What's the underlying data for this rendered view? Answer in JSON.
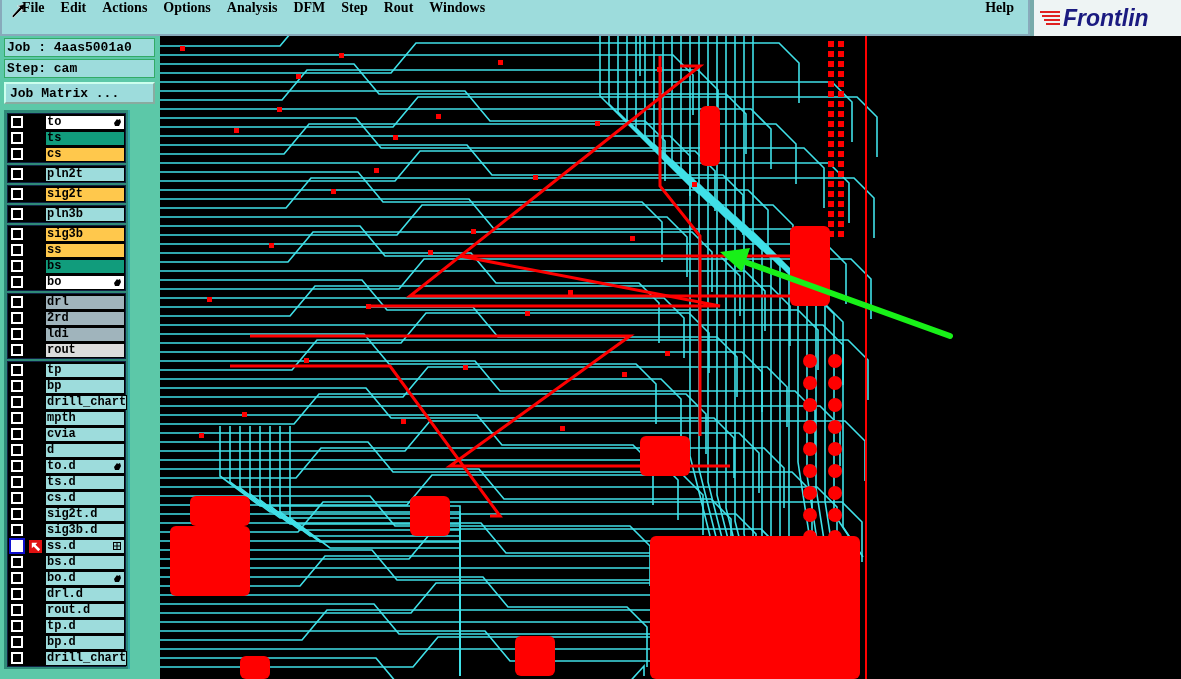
{
  "menu_bar": {
    "items": [
      {
        "label": "File"
      },
      {
        "label": "Edit"
      },
      {
        "label": "Actions"
      },
      {
        "label": "Options"
      },
      {
        "label": "Analysis"
      },
      {
        "label": "DFM"
      },
      {
        "label": "Step"
      },
      {
        "label": "Rout"
      },
      {
        "label": "Windows"
      }
    ],
    "help": "Help"
  },
  "logo": {
    "text": "Frontlin"
  },
  "job_panel": {
    "job": "Job : 4aas5001a0",
    "step": "Step: cam",
    "matrix_button": "Job Matrix ..."
  },
  "layer_groups": [
    {
      "layers": [
        {
          "name": "to",
          "color": "#ffffff",
          "hand_mark": true,
          "checked": false,
          "selected": false
        },
        {
          "name": "ts",
          "color": "#119c7c",
          "checked": false,
          "selected": false
        },
        {
          "name": "cs",
          "color": "#ffc84c",
          "checked": false,
          "selected": false
        }
      ]
    },
    {
      "layers": [
        {
          "name": "pln2t",
          "color": "#9ddcdc",
          "checked": false,
          "selected": false
        }
      ]
    },
    {
      "layers": [
        {
          "name": "sig2t",
          "color": "#ffc84c",
          "checked": false,
          "selected": false
        }
      ]
    },
    {
      "layers": [
        {
          "name": "pln3b",
          "color": "#9ddcdc",
          "checked": false,
          "selected": false
        }
      ]
    },
    {
      "layers": [
        {
          "name": "sig3b",
          "color": "#ffc84c",
          "checked": false,
          "selected": false
        },
        {
          "name": "ss",
          "color": "#ffc84c",
          "checked": false,
          "selected": false
        },
        {
          "name": "bs",
          "color": "#119c7c",
          "checked": false,
          "selected": false
        },
        {
          "name": "bo",
          "color": "#ffffff",
          "hand_mark": true,
          "checked": false,
          "selected": false
        }
      ]
    },
    {
      "layers": [
        {
          "name": "drl",
          "color": "#a0b4bc",
          "checked": false,
          "selected": false
        },
        {
          "name": "2rd",
          "color": "#a0b4bc",
          "checked": false,
          "selected": false
        },
        {
          "name": "ldi",
          "color": "#a0b4bc",
          "checked": false,
          "selected": false
        },
        {
          "name": "rout",
          "color": "#dcdcdc",
          "checked": false,
          "selected": false
        }
      ]
    },
    {
      "layers": [
        {
          "name": "tp",
          "color": "#9ddcdc",
          "checked": false,
          "selected": false
        },
        {
          "name": "bp",
          "color": "#9ddcdc",
          "checked": false,
          "selected": false
        },
        {
          "name": "drill_chart",
          "color": "#9ddcdc",
          "checked": false,
          "selected": false
        },
        {
          "name": "mpth",
          "color": "#9ddcdc",
          "checked": false,
          "selected": false
        },
        {
          "name": "cvia",
          "color": "#9ddcdc",
          "checked": false,
          "selected": false
        },
        {
          "name": "d",
          "color": "#9ddcdc",
          "checked": false,
          "selected": false
        },
        {
          "name": "to.d",
          "color": "#9ddcdc",
          "hand_mark": true,
          "checked": false,
          "selected": false
        },
        {
          "name": "ts.d",
          "color": "#9ddcdc",
          "checked": false,
          "selected": false
        },
        {
          "name": "cs.d",
          "color": "#9ddcdc",
          "checked": false,
          "selected": false
        },
        {
          "name": "sig2t.d",
          "color": "#9ddcdc",
          "checked": false,
          "selected": false
        },
        {
          "name": "sig3b.d",
          "color": "#9ddcdc",
          "checked": false,
          "selected": false
        },
        {
          "name": "ss.d",
          "color": "#9ddcdc",
          "grid_mark": true,
          "checked": false,
          "selected": true
        },
        {
          "name": "bs.d",
          "color": "#9ddcdc",
          "checked": false,
          "selected": false
        },
        {
          "name": "bo.d",
          "color": "#9ddcdc",
          "hand_mark": true,
          "checked": false,
          "selected": false
        },
        {
          "name": "drl.d",
          "color": "#9ddcdc",
          "checked": false,
          "selected": false
        },
        {
          "name": "rout.d",
          "color": "#9ddcdc",
          "checked": false,
          "selected": false
        },
        {
          "name": "tp.d",
          "color": "#9ddcdc",
          "checked": false,
          "selected": false
        },
        {
          "name": "bp.d",
          "color": "#9ddcdc",
          "checked": false,
          "selected": false
        },
        {
          "name": "drill_chart",
          "color": "#9ddcdc",
          "checked": false,
          "selected": false
        }
      ]
    }
  ]
}
